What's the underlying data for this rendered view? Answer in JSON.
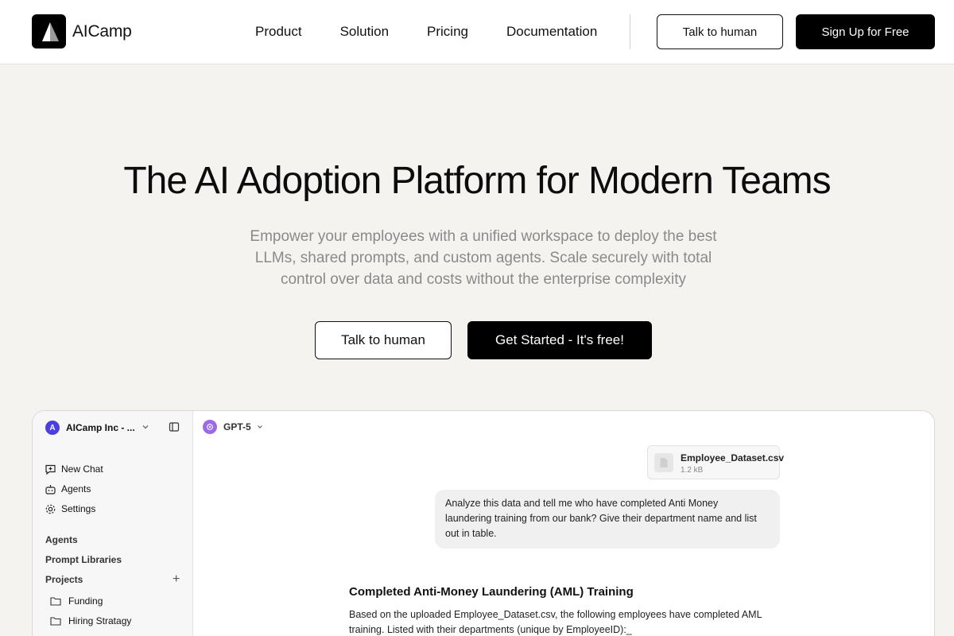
{
  "brand": {
    "name": "AICamp"
  },
  "nav": {
    "items": [
      "Product",
      "Solution",
      "Pricing",
      "Documentation"
    ],
    "talk_label": "Talk to human",
    "signup_label": "Sign Up for Free"
  },
  "hero": {
    "title": "The AI Adoption Platform for Modern Teams",
    "subtitle_lines": [
      "Empower your employees with a unified workspace to deploy the best",
      "LLMs, shared prompts, and custom agents. Scale securely with total",
      "control over data and costs without the enterprise complexity"
    ],
    "talk_label": "Talk to human",
    "cta_label": "Get Started - It's free!"
  },
  "app": {
    "workspace": {
      "initial": "A",
      "name": "AICamp Inc - ..."
    },
    "sidebar": {
      "actions": [
        {
          "label": "New Chat",
          "icon": "new-chat-icon"
        },
        {
          "label": "Agents",
          "icon": "robot-icon"
        },
        {
          "label": "Settings",
          "icon": "gear-icon"
        }
      ],
      "sections": [
        "Agents",
        "Prompt Libraries",
        "Projects"
      ],
      "folders": [
        "Funding",
        "Hiring Stratagy"
      ]
    },
    "model": "GPT-5",
    "attachment": {
      "name": "Employee_Dataset.csv",
      "size": "1.2 kB"
    },
    "user_message_lines": [
      "Analyze this data and tell me who have completed Anti Money",
      "laundering training from our bank? Give their department name and list",
      "out in table."
    ],
    "response": {
      "title": "Completed Anti-Money Laundering (AML) Training",
      "lines": [
        "Based on the uploaded Employee_Dataset.csv, the following employees have completed AML",
        "training. Listed with their departments (unique by EmployeeID):_"
      ]
    }
  },
  "colors": {
    "accent": "#000000",
    "background": "#f4f3f0",
    "workspace_avatar": "#4b3fe0",
    "model_icon": "#9b6ae6"
  }
}
